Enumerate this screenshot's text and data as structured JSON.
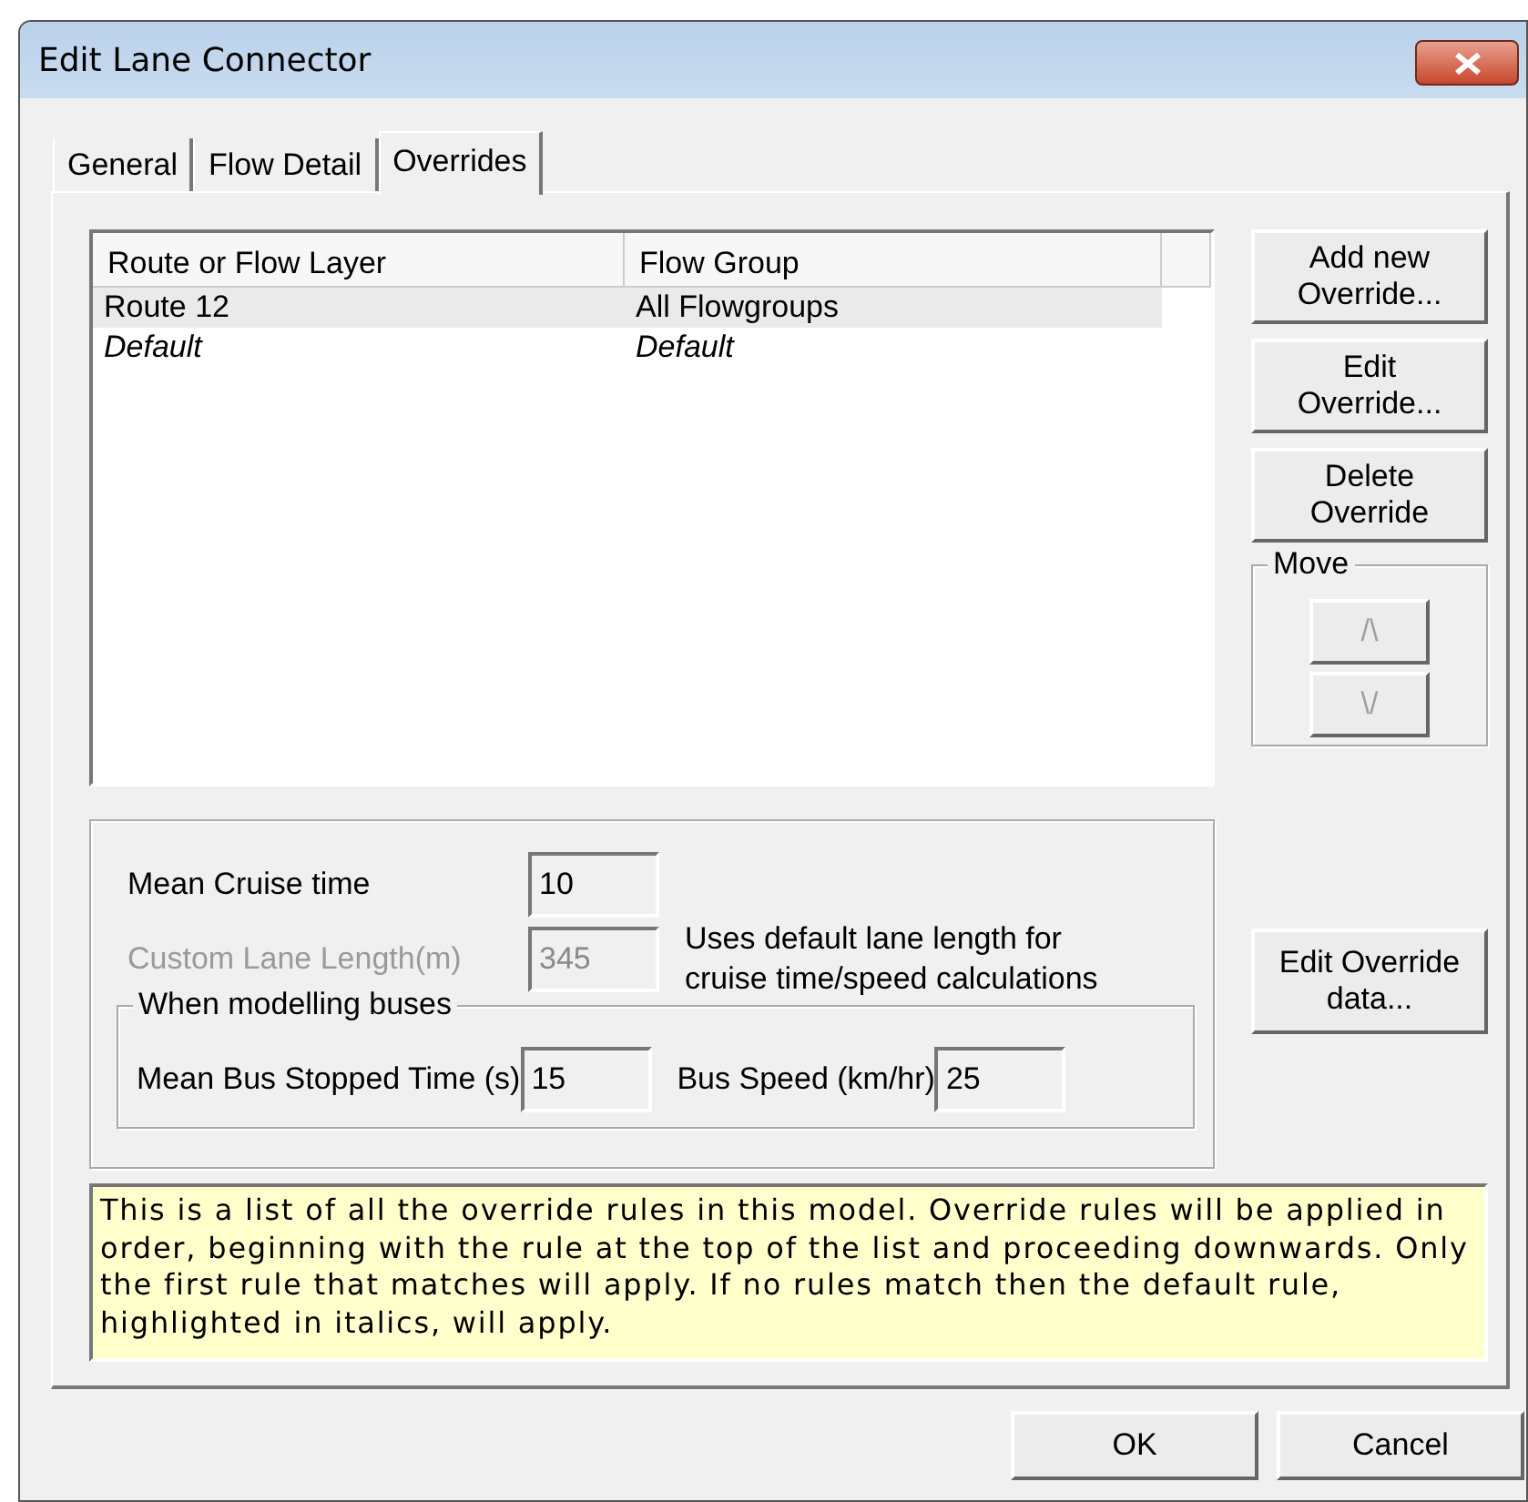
{
  "window": {
    "title": "Edit Lane Connector"
  },
  "tabs": [
    {
      "label": "General",
      "selected": false
    },
    {
      "label": "Flow Detail",
      "selected": false
    },
    {
      "label": "Overrides",
      "selected": true
    }
  ],
  "list": {
    "columns": [
      "Route or Flow Layer",
      "Flow Group"
    ],
    "rows": [
      {
        "cells": [
          "Route 12",
          "All Flowgroups"
        ],
        "selected": true,
        "italic": false
      },
      {
        "cells": [
          "Default",
          "Default"
        ],
        "selected": false,
        "italic": true
      }
    ]
  },
  "side_buttons": [
    {
      "label": "Add new\nOverride..."
    },
    {
      "label": "Edit\nOverride..."
    },
    {
      "label": "Delete\nOverride"
    }
  ],
  "move": {
    "title": "Move",
    "buttons": [
      {
        "label": "/\\",
        "disabled": true
      },
      {
        "label": "\\/",
        "disabled": true
      }
    ]
  },
  "fields": [
    {
      "label": "Mean Cruise time",
      "value": "10",
      "disabled": false
    },
    {
      "label": "Custom Lane Length(m)",
      "value": "345",
      "disabled": true
    }
  ],
  "lane_note": "Uses default lane length for\ncruise time/speed calculations",
  "bus_group": {
    "title": "When modelling buses",
    "fields": [
      {
        "label": "Mean Bus Stopped Time (s)",
        "value": "15"
      },
      {
        "label": "Bus Speed (km/hr)",
        "value": "25"
      }
    ]
  },
  "edit_data_button": "Edit Override\ndata...",
  "info": "This is a list of all the override rules in this model. Override rules will be applied in order, beginning with the rule at the top of the list and proceeding downwards. Only the first rule that matches will apply. If no rules match then the default rule, highlighted in italics, will apply.",
  "footer_buttons": [
    "OK",
    "Cancel"
  ]
}
